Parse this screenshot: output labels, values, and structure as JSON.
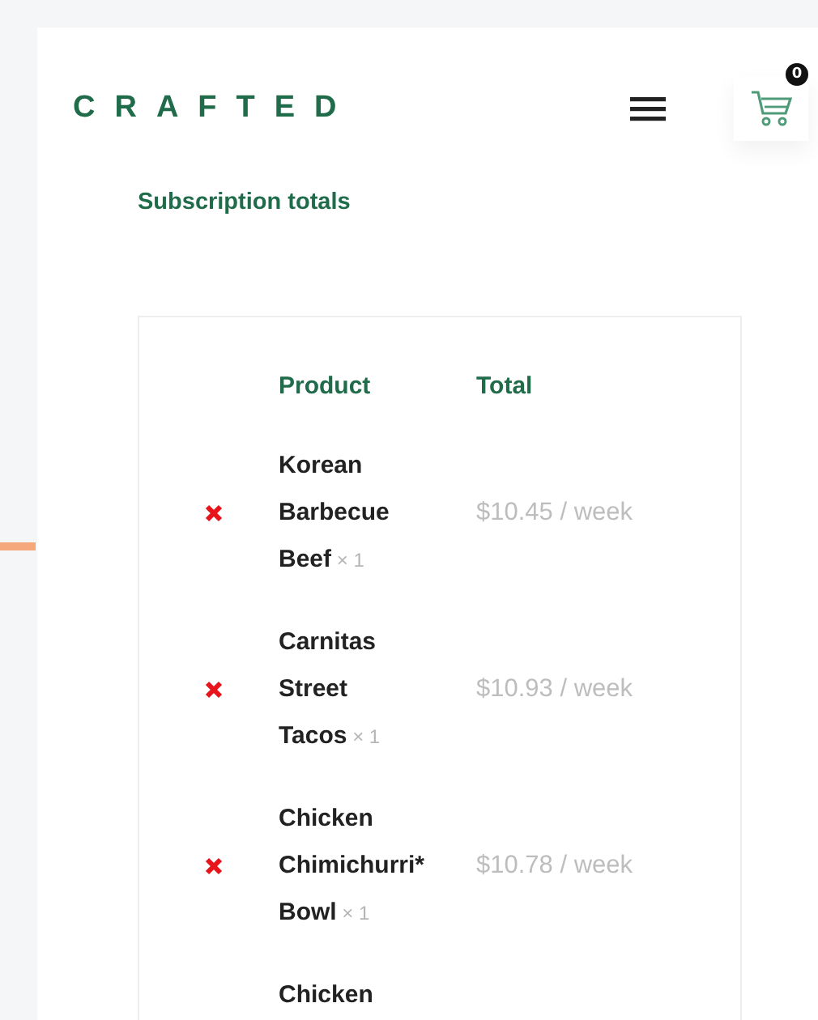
{
  "header": {
    "logo": "CRAFTED",
    "cart_count": "0"
  },
  "section_title": "Subscription totals",
  "table": {
    "columns": [
      "Product",
      "Total"
    ],
    "rows": [
      {
        "name": "Korean Barbecue Beef",
        "quantity": "× 1",
        "total": "$10.45 / week"
      },
      {
        "name": "Carnitas Street Tacos",
        "quantity": "× 1",
        "total": "$10.93 / week"
      },
      {
        "name": "Chicken Chimichurri* Bowl",
        "quantity": "× 1",
        "total": "$10.78 / week"
      },
      {
        "name": "Chicken"
      }
    ]
  }
}
